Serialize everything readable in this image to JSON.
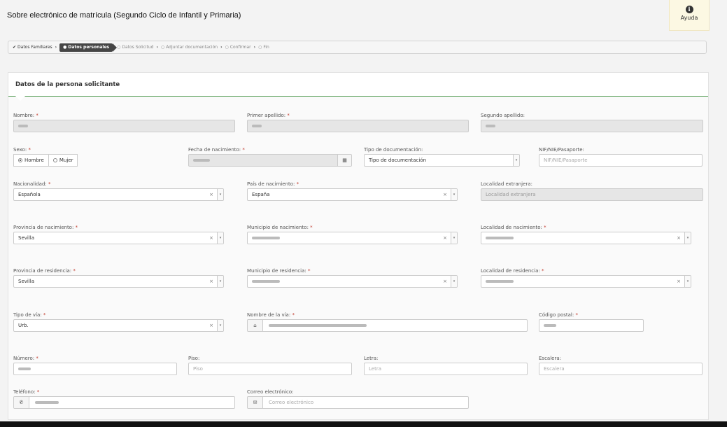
{
  "header": {
    "title": "Sobre electrónico de matrícula (Segundo Ciclo de Infantil y Primaria)"
  },
  "help": {
    "label": "Ayuda"
  },
  "steps": [
    {
      "label": "Datos Familiares",
      "state": "done"
    },
    {
      "label": "Datos personales",
      "state": "active"
    },
    {
      "label": "Datos Solicitud",
      "state": "pending"
    },
    {
      "label": "Adjuntar documentación",
      "state": "pending"
    },
    {
      "label": "Confirmar",
      "state": "pending"
    },
    {
      "label": "Fin",
      "state": "pending"
    }
  ],
  "panel": {
    "title": "Datos de la persona solicitante"
  },
  "form": {
    "nombre_label": "Nombre:",
    "primer_apellido_label": "Primer apellido:",
    "segundo_apellido_label": "Segundo apellido:",
    "sexo_label": "Sexo:",
    "sexo_hombre": "Hombre",
    "sexo_mujer": "Mujer",
    "fecha_label": "Fecha de nacimiento:",
    "tipo_doc_label": "Tipo de documentación:",
    "tipo_doc_value": "Tipo de documentación",
    "nif_label": "NIF/NIE/Pasaporte:",
    "nif_placeholder": "NIF/NIE/Pasaporte",
    "nacionalidad_label": "Nacionalidad:",
    "nacionalidad_value": "Española",
    "pais_label": "País de nacimiento:",
    "pais_value": "España",
    "localidad_ext_label": "Localidad extranjera:",
    "localidad_ext_placeholder": "Localidad extranjera",
    "prov_nac_label": "Provincia de nacimiento:",
    "prov_nac_value": "Sevilla",
    "mun_nac_label": "Municipio de nacimiento:",
    "loc_nac_label": "Localidad de nacimiento:",
    "prov_res_label": "Provincia de residencia:",
    "prov_res_value": "Sevilla",
    "mun_res_label": "Municipio de residencia:",
    "loc_res_label": "Localidad de residencia:",
    "tipo_via_label": "Tipo de vía:",
    "tipo_via_value": "Urb.",
    "nombre_via_label": "Nombre de la vía:",
    "cp_label": "Código postal:",
    "numero_label": "Número:",
    "piso_label": "Piso:",
    "piso_placeholder": "Piso",
    "letra_label": "Letra:",
    "letra_placeholder": "Letra",
    "escalera_label": "Escalera:",
    "escalera_placeholder": "Escalera",
    "telefono_label": "Teléfono:",
    "correo_label": "Correo electrónico:",
    "correo_placeholder": "Correo electrónico",
    "required_mark": "*"
  }
}
